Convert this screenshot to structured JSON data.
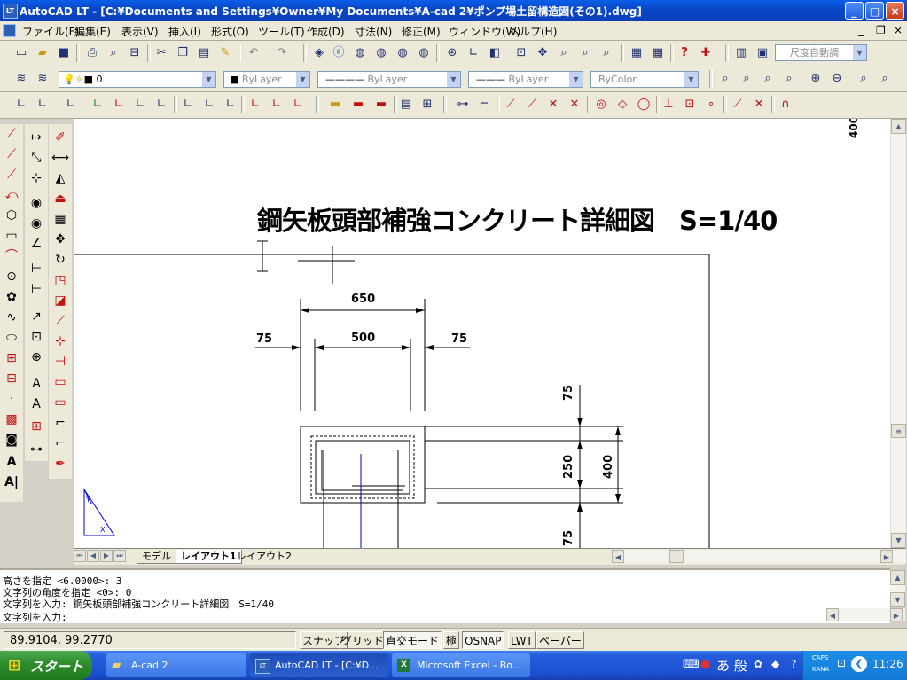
{
  "window": {
    "title": "AutoCAD LT - [C:¥Documents and Settings¥Owner¥My Documents¥A-cad 2¥ポンプ場土留構造図(その1).dwg]",
    "app_icon_label": "LT",
    "minimize": "_",
    "maximize": "□",
    "close": "×"
  },
  "menu": {
    "items": [
      "ファイル(F)",
      "編集(E)",
      "表示(V)",
      "挿入(I)",
      "形式(O)",
      "ツール(T)",
      "作成(D)",
      "寸法(N)",
      "修正(M)",
      "ウィンドウ(W)",
      "ヘルプ(H)"
    ],
    "mdi_min": "_",
    "mdi_restore": "❐",
    "mdi_close": "×"
  },
  "toolbar": {
    "dim_style": "尺度自動調",
    "color": "ByLayer",
    "linetype": "ByLayer",
    "lineweight": "ByLayer",
    "plotstyle": "ByColor",
    "layer": "0"
  },
  "drawing": {
    "title": "鋼矢板頭部補強コンクリート詳細図　S=1/40",
    "corner_dim": "400",
    "dims": {
      "top_650": "650",
      "mid_500": "500",
      "left_75": "75",
      "right_75": "75",
      "v_75_top": "75",
      "v_250": "250",
      "v_400": "400",
      "v_75_bottom": "75"
    },
    "ucs_labels": {
      "y": "Y",
      "x": "X"
    }
  },
  "tabs": {
    "model": "モデル",
    "layout1": "レイアウト1",
    "layout2": "レイアウト2"
  },
  "command": {
    "lines": [
      "高さを指定 <6.0000>: 3",
      "文字列の角度を指定 <0>: 0",
      "文字列を入力: 鋼矢板頭部補強コンクリート詳細図　S=1/40"
    ],
    "prompt": "文字列を入力:"
  },
  "status": {
    "coords": "89.9104, 99.2770",
    "snap": "スナップ",
    "grid": "グリッド",
    "ortho": "直交モード",
    "polar": "極",
    "osnap": "OSNAP",
    "lwt": "LWT",
    "paper": "ペーパー"
  },
  "taskbar": {
    "start": "スタート",
    "tasks": [
      "A-cad 2",
      "AutoCAD LT - [C:¥D...",
      "Microsoft Excel - Bo..."
    ],
    "ime": "あ 般",
    "caps": "CAPS",
    "kana": "KANA",
    "clock": "11:26"
  },
  "colors": {
    "titlebar": "#0a5ee8",
    "drawing_bg": "#ffffff",
    "axis_blue": "#0000cc",
    "toolbar_bg": "#ece9d8"
  }
}
